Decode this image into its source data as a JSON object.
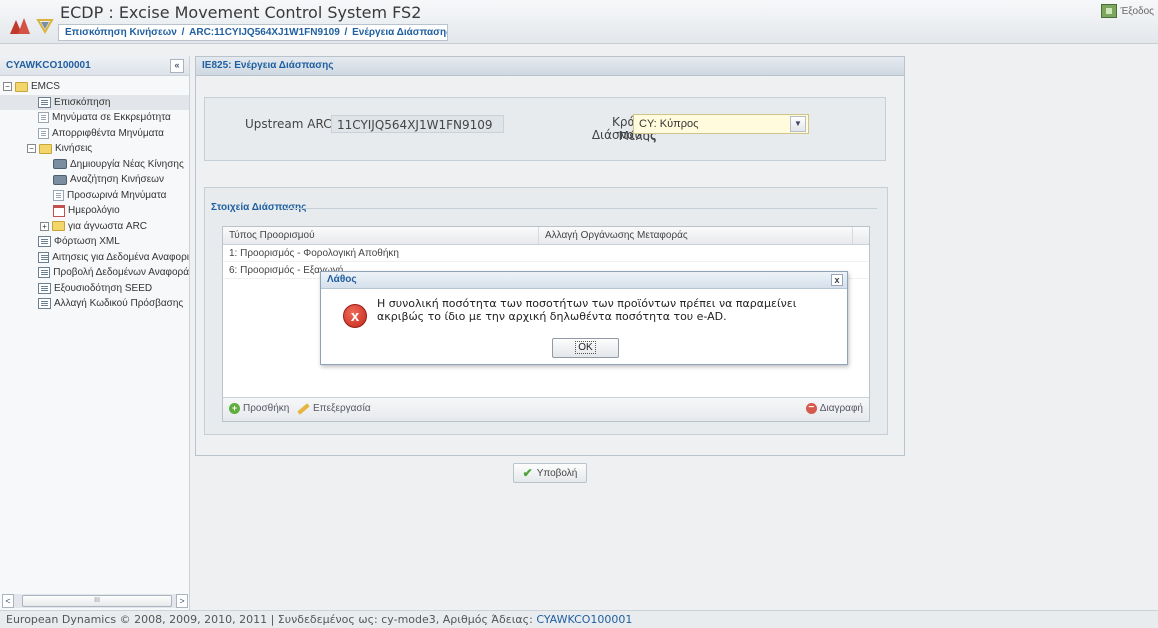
{
  "app": {
    "title": "ECDP : Excise Movement Control System FS2",
    "exit_label": "Έξοδος"
  },
  "breadcrumb": {
    "part1": "Επισκόπηση Κινήσεων",
    "part2": "ARC:11CYIJQ564XJ1W1FN9109",
    "part3": "Ενέργεια Διάσπασης",
    "separator": "/"
  },
  "sidebar": {
    "header": "CYAWKCO100001",
    "collapse_label": "«",
    "items": [
      {
        "label": "EMCS"
      },
      {
        "label": "Επισκόπηση"
      },
      {
        "label": "Μηνύματα σε Εκκρεμότητα"
      },
      {
        "label": "Απορριφθέντα Μηνύματα"
      },
      {
        "label": "Κινήσεις"
      },
      {
        "label": "Δημιουργία Νέας Κίνησης"
      },
      {
        "label": "Αναζήτηση Κινήσεων"
      },
      {
        "label": "Προσωρινά Μηνύματα"
      },
      {
        "label": "Ημερολόγιο"
      },
      {
        "label": "για άγνωστα ARC"
      },
      {
        "label": "Φόρτωση XML"
      },
      {
        "label": "Αιτησεις για Δεδομένα Αναφορι"
      },
      {
        "label": "Προβολή Δεδομένων Αναφορά"
      },
      {
        "label": "Εξουσιοδότηση SEED"
      },
      {
        "label": "Αλλαγή Κωδικού Πρόσβασης"
      }
    ],
    "scroll_left": "<",
    "scroll_right": ">",
    "scroll_thumb": "III"
  },
  "panel": {
    "title": "IE825: Ενέργεια Διάσπασης",
    "upstream_arc_label": "Upstream ARC",
    "upstream_arc_value": "11CYIJQ564XJ1W1FN9109",
    "member_state_label_1": "Κράτος Μέλος",
    "member_state_label_2": "Διάσπασης",
    "member_state_value": "CY: Κύπρος",
    "split_section_title": "Στοιχεία Διάσπασης",
    "grid": {
      "columns": [
        "Τύπος Προορισμού",
        "Αλλαγή Οργάνωσης Μεταφοράς"
      ],
      "rows": [
        [
          "1: Προορισμός - Φορολογική Αποθήκη",
          ""
        ],
        [
          "6: Προορισμός - Εξαγωγή",
          ""
        ]
      ]
    },
    "add_label": "Προσθήκη",
    "edit_label": "Επεξεργασία",
    "delete_label": "Διαγραφή",
    "submit_label": "Υποβολή"
  },
  "dialog": {
    "title": "Λάθος",
    "close_label": "x",
    "icon_glyph": "x",
    "message": "Η συνολική ποσότητα των ποσοτήτων των προϊόντων πρέπει να παραμείνει ακριβώς το ίδιο με την αρχική δηλωθέντα ποσότητα του e-AD.",
    "ok_label": "OK"
  },
  "footer": {
    "text": "European Dynamics © 2008, 2009, 2010, 2011 | Συνδεδεμένος ως: cy-mode3, Αριθμός Άδειας: ",
    "license": "CYAWKCO100001"
  },
  "colors": {
    "accent": "#1f5fa0",
    "error": "#c3281b",
    "select_bg": "#fffbdc"
  }
}
